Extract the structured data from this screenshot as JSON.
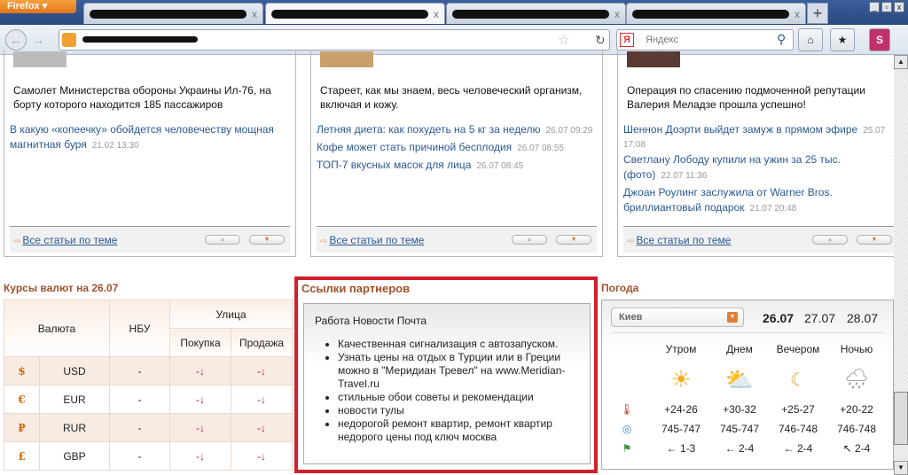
{
  "browser": {
    "menu_label": "Firefox",
    "search_placeholder": "Яндекс",
    "new_tab": "+",
    "tab_close": "x"
  },
  "news": [
    {
      "lead": "Самолет Министерства обороны Украины Ил-76, на борту которого находится 185 пассажиров",
      "links": [
        {
          "title": "В какую «копеечку» обойдется человечеству мощная магнитная буря",
          "date": "21.02 13:30"
        }
      ],
      "all": "Все статьи по теме"
    },
    {
      "lead": "Стареет, как мы знаем, весь человеческий организм, включая и кожу.",
      "links": [
        {
          "title": "Летняя диета: как похудеть на 5 кг за неделю",
          "date": "26.07 09:29"
        },
        {
          "title": "Кофе может стать причиной бесплодия",
          "date": "26.07 08:55"
        },
        {
          "title": "ТОП-7 вкусных масок для лица",
          "date": "26.07 08:45"
        }
      ],
      "all": "Все статьи по теме"
    },
    {
      "lead": "Операция по спасению подмоченной репутации Валерия Меладзе прошла успешно!",
      "links": [
        {
          "title": "Шеннон Доэрти выйдет замуж в прямом эфире",
          "date": "25.07 17:08"
        },
        {
          "title": "Светлану Лободу купили на ужин за 25 тыс. (фото)",
          "date": "22.07 11:36"
        },
        {
          "title": "Джоан Роулинг заслужила от Warner Bros. бриллиантовый подарок",
          "date": "21.07 20:48"
        }
      ],
      "all": "Все статьи по теме"
    }
  ],
  "currency": {
    "title": "Курсы валют на 26.07",
    "h_currency": "Валюта",
    "h_nbu": "НБУ",
    "h_street": "Улица",
    "h_buy": "Покупка",
    "h_sell": "Продажа",
    "rows": [
      {
        "sym": "$",
        "code": "USD",
        "nbu": "-",
        "buy": "-↓",
        "sell": "-↓"
      },
      {
        "sym": "€",
        "code": "EUR",
        "nbu": "-",
        "buy": "-↓",
        "sell": "-↓"
      },
      {
        "sym": "₽",
        "code": "RUR",
        "nbu": "-",
        "buy": "-↓",
        "sell": "-↓"
      },
      {
        "sym": "£",
        "code": "GBP",
        "nbu": "-",
        "buy": "-↓",
        "sell": "-↓"
      }
    ]
  },
  "partners": {
    "title": "Ссылки партнеров",
    "top": "Работа Новости Почта",
    "items": [
      "Качественная сигнализация с автозапуском.",
      "Узнать цены на отдых в Турции или в Греции можно в \"Меридиан Тревел\" на www.Meridian-Travel.ru",
      "стильные обои советы и рекомендации",
      "новости тулы",
      "недорогой ремонт квартир, ремонт квартир недорого цены под ключ москва"
    ]
  },
  "weather": {
    "title": "Погода",
    "city": "Киев",
    "dates": [
      "26.07",
      "27.07",
      "28.07"
    ],
    "periods": [
      "Утром",
      "Днем",
      "Вечером",
      "Ночью"
    ],
    "icons": [
      "☀",
      "⛅",
      "☾",
      "🌧"
    ],
    "temp": [
      "+24-26",
      "+30-32",
      "+25-27",
      "+20-22"
    ],
    "pressure": [
      "745-747",
      "745-747",
      "746-748",
      "746-748"
    ],
    "wind": [
      "← 1-3",
      "← 2-4",
      "← 2-4",
      "↖ 2-4"
    ]
  },
  "colors": {
    "accent": "#a0522d",
    "partner_border": "#d0202a",
    "link": "#2a5a94"
  }
}
